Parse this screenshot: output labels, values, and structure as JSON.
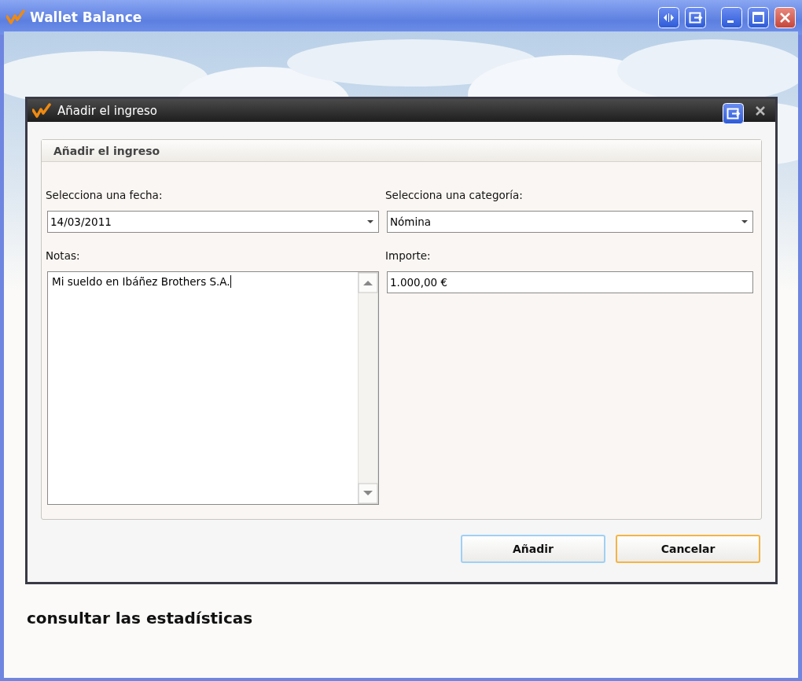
{
  "window": {
    "title": "Wallet Balance"
  },
  "welcome": {
    "lines": [
      "consultar las estadísticas"
    ]
  },
  "dialog": {
    "title": "Añadir el ingreso",
    "group_title": "Añadir el ingreso",
    "fields": [
      {
        "kind": "dropdown",
        "label": "Selecciona una fecha:",
        "value": "14/03/2011"
      },
      {
        "kind": "dropdown",
        "label": "Selecciona una categoría:",
        "value": "Nómina"
      },
      {
        "kind": "textarea",
        "label": "Notas:",
        "value": "Mi sueldo en Ibáñez Brothers S.A."
      },
      {
        "kind": "text",
        "label": "Importe:",
        "value": "1.000,00 €"
      }
    ],
    "buttons": [
      {
        "label": "Añadir",
        "kind": "default"
      },
      {
        "label": "Cancelar",
        "kind": "focused"
      }
    ]
  }
}
